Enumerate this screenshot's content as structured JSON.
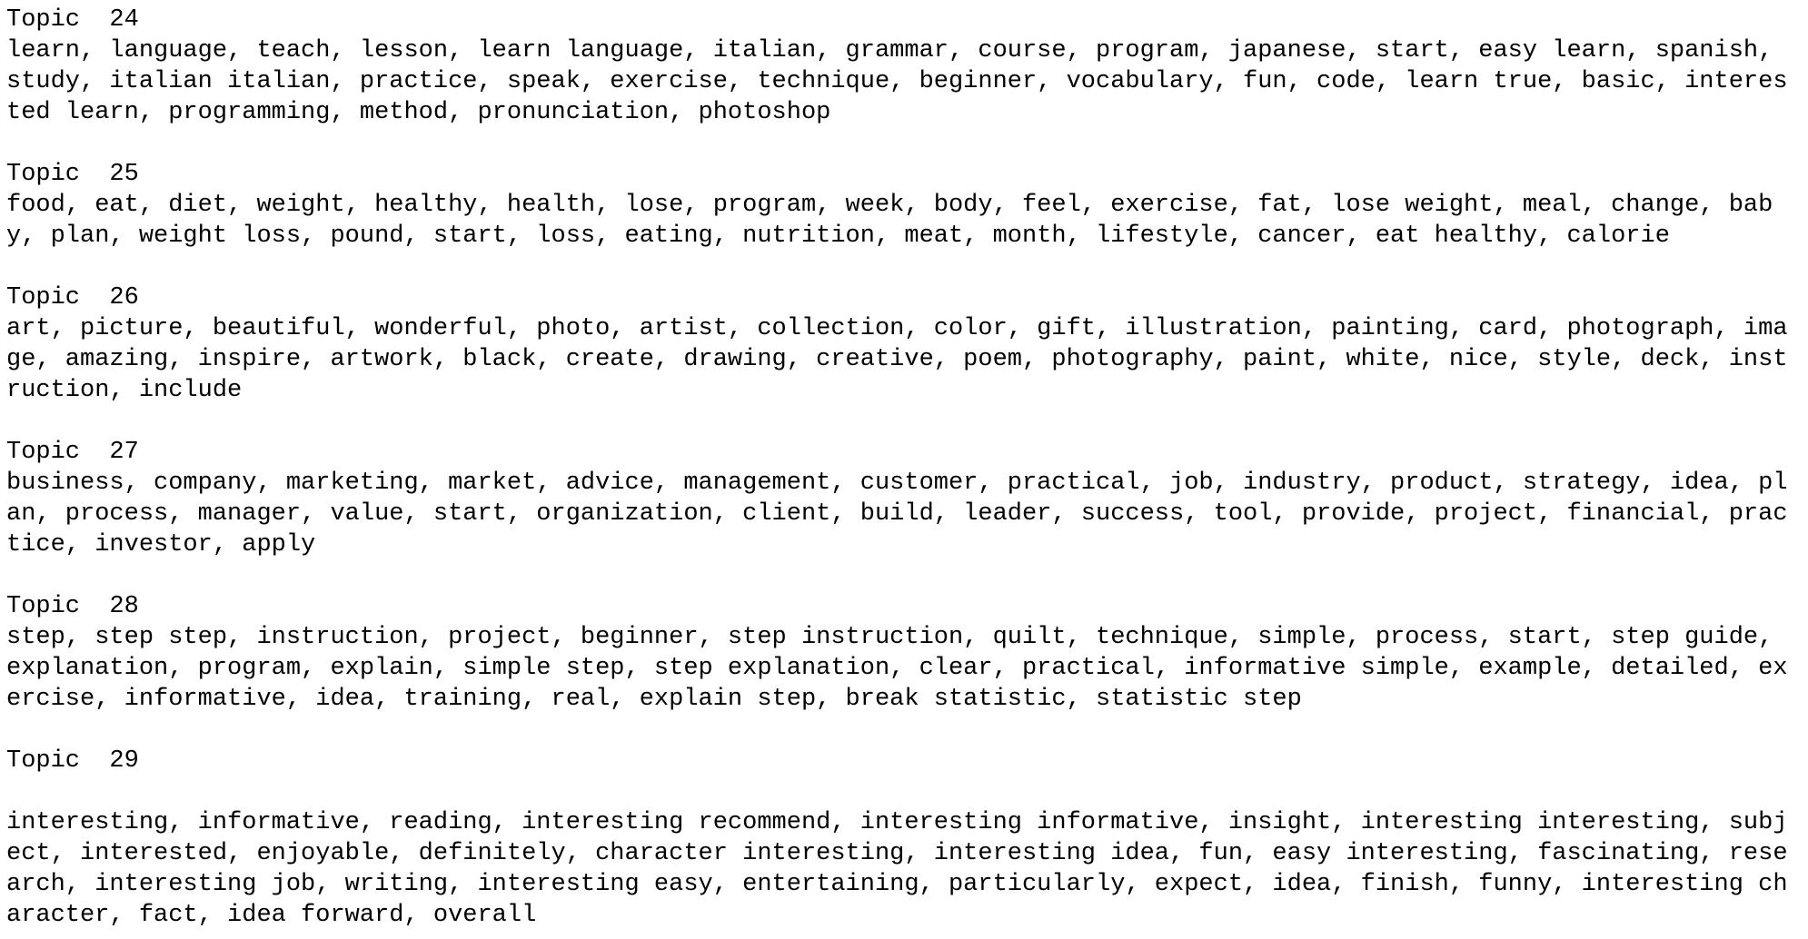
{
  "topics": [
    {
      "label": "Topic",
      "number": "24",
      "terms": "learn, language, teach, lesson, learn language, italian, grammar, course, program, japanese, start, easy learn, spanish, study, italian italian, practice, speak, exercise, technique, beginner, vocabulary, fun, code, learn true, basic, interested learn, programming, method, pronunciation, photoshop"
    },
    {
      "label": "Topic",
      "number": "25",
      "terms": "food, eat, diet, weight, healthy, health, lose, program, week, body, feel, exercise, fat, lose weight, meal, change, baby, plan, weight loss, pound, start, loss, eating, nutrition, meat, month, lifestyle, cancer, eat healthy, calorie"
    },
    {
      "label": "Topic",
      "number": "26",
      "terms": "art, picture, beautiful, wonderful, photo, artist, collection, color, gift, illustration, painting, card, photograph, image, amazing, inspire, artwork, black, create, drawing, creative, poem, photography, paint, white, nice, style, deck, instruction, include"
    },
    {
      "label": "Topic",
      "number": "27",
      "terms": "business, company, marketing, market, advice, management, customer, practical, job, industry, product, strategy, idea, plan, process, manager, value, start, organization, client, build, leader, success, tool, provide, project, financial, practice, investor, apply"
    },
    {
      "label": "Topic",
      "number": "28",
      "terms": "step, step step, instruction, project, beginner, step instruction, quilt, technique, simple, process, start, step guide, explanation, program, explain, simple step, step explanation, clear, practical, informative simple, example, detailed, exercise, informative, idea, training, real, explain step, break statistic, statistic step"
    },
    {
      "label": "Topic",
      "number": "29",
      "terms": "interesting, informative, reading, interesting recommend, interesting informative, insight, interesting interesting, subject, interested, enjoyable, definitely, character interesting, interesting idea, fun, easy interesting, fascinating, research, interesting job, writing, interesting easy, entertaining, particularly, expect, idea, finish, funny, interesting character, fact, idea forward, overall"
    }
  ]
}
